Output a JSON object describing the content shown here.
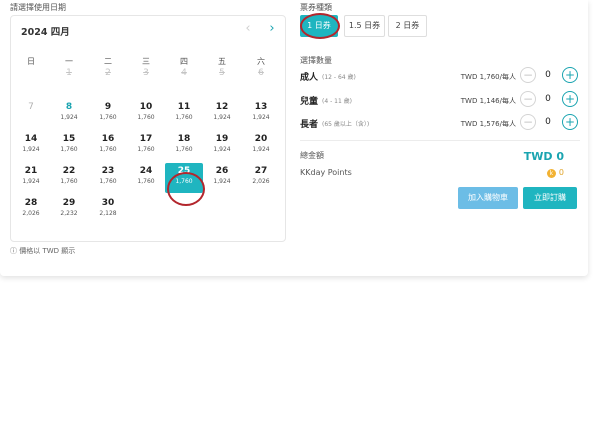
{
  "date_section": {
    "title": "請選擇使用日期",
    "month_label": "2024 四月",
    "price_note": "ⓘ 價格以 TWD 顯示"
  },
  "weekdays": [
    "日",
    "一",
    "二",
    "三",
    "四",
    "五",
    "六"
  ],
  "calendar": {
    "weeks": [
      [
        {
          "d": "",
          "p": ""
        },
        {
          "d": "1",
          "p": "",
          "s": "past"
        },
        {
          "d": "2",
          "p": "",
          "s": "past"
        },
        {
          "d": "3",
          "p": "",
          "s": "past"
        },
        {
          "d": "4",
          "p": "",
          "s": "past"
        },
        {
          "d": "5",
          "p": "",
          "s": "past"
        },
        {
          "d": "6",
          "p": "",
          "s": "past"
        }
      ],
      [
        {
          "d": "7",
          "p": "",
          "s": "muted"
        },
        {
          "d": "8",
          "p": "1,924",
          "s": "today"
        },
        {
          "d": "9",
          "p": "1,760"
        },
        {
          "d": "10",
          "p": "1,760"
        },
        {
          "d": "11",
          "p": "1,760"
        },
        {
          "d": "12",
          "p": "1,924"
        },
        {
          "d": "13",
          "p": "1,924"
        }
      ],
      [
        {
          "d": "14",
          "p": "1,924"
        },
        {
          "d": "15",
          "p": "1,760"
        },
        {
          "d": "16",
          "p": "1,760"
        },
        {
          "d": "17",
          "p": "1,760"
        },
        {
          "d": "18",
          "p": "1,760"
        },
        {
          "d": "19",
          "p": "1,924"
        },
        {
          "d": "20",
          "p": "1,924"
        }
      ],
      [
        {
          "d": "21",
          "p": "1,924"
        },
        {
          "d": "22",
          "p": "1,760"
        },
        {
          "d": "23",
          "p": "1,760"
        },
        {
          "d": "24",
          "p": "1,760"
        },
        {
          "d": "25",
          "p": "1,760",
          "s": "sel"
        },
        {
          "d": "26",
          "p": "1,924"
        },
        {
          "d": "27",
          "p": "2,026"
        }
      ],
      [
        {
          "d": "28",
          "p": "2,026"
        },
        {
          "d": "29",
          "p": "2,232"
        },
        {
          "d": "30",
          "p": "2,128"
        },
        {
          "d": "",
          "p": ""
        },
        {
          "d": "",
          "p": ""
        },
        {
          "d": "",
          "p": ""
        },
        {
          "d": "",
          "p": ""
        }
      ]
    ]
  },
  "ticket_section": {
    "title": "票券種類",
    "tabs": [
      "1 日券",
      "1.5 日券",
      "2 日券"
    ],
    "selected": "1 日券"
  },
  "quantity_section": {
    "title": "選擇數量",
    "rows": [
      {
        "label": "成人",
        "age": "(12 - 64 歲)",
        "price": "TWD 1,760/每人",
        "count": "0"
      },
      {
        "label": "兒童",
        "age": "(4 - 11 歲)",
        "price": "TWD 1,146/每人",
        "count": "0"
      },
      {
        "label": "長者",
        "age": "(65 歲以上（含）)",
        "price": "TWD 1,576/每人",
        "count": "0"
      }
    ]
  },
  "summary": {
    "total_label": "總金額",
    "total_value": "TWD 0",
    "points_label": "KKday Points",
    "points_value": "0"
  },
  "actions": {
    "add_to_cart": "加入購物車",
    "book_now": "立即訂購"
  },
  "colors": {
    "accent": "#1fb5c0",
    "cart": "#6cbde6",
    "highlight_ring": "#b3262d",
    "points": "#e0a52b"
  }
}
